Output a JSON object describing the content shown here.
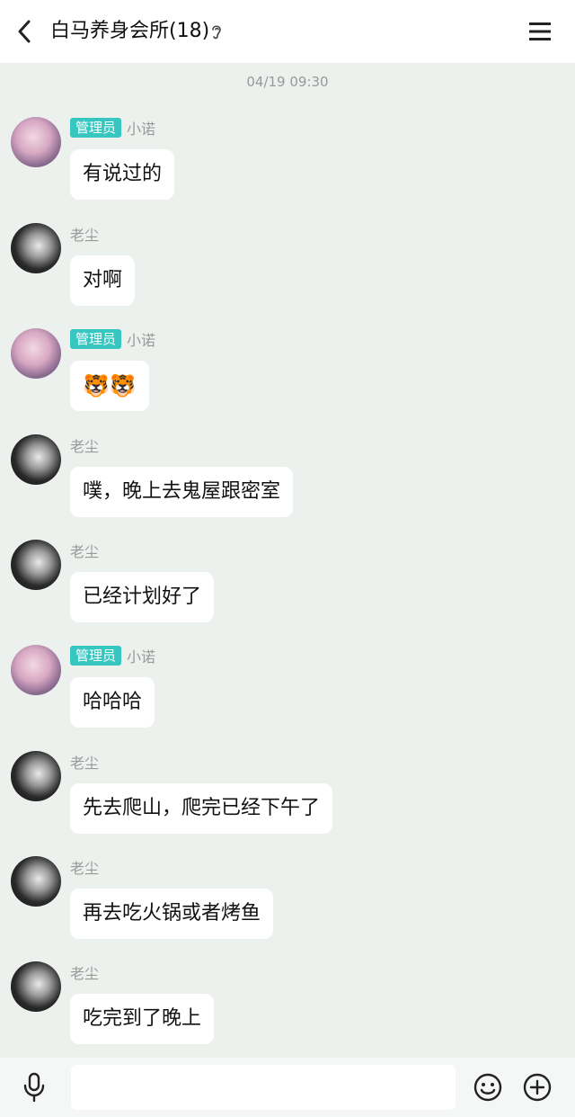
{
  "header": {
    "title": "白马养身会所(18)"
  },
  "timestamp": "04/19 09:30",
  "messages": [
    {
      "sender": "小诺",
      "badge": "管理员",
      "text": "有说过的"
    },
    {
      "sender": "老尘",
      "text": "对啊"
    },
    {
      "sender": "小诺",
      "badge": "管理员",
      "text": "🐯🐯"
    },
    {
      "sender": "老尘",
      "text": "噗，晚上去鬼屋跟密室"
    },
    {
      "sender": "老尘",
      "text": "已经计划好了"
    },
    {
      "sender": "小诺",
      "badge": "管理员",
      "text": "哈哈哈"
    },
    {
      "sender": "老尘",
      "text": "先去爬山，爬完已经下午了"
    },
    {
      "sender": "老尘",
      "text": "再去吃火锅或者烤鱼"
    },
    {
      "sender": "老尘",
      "text": "吃完到了晚上"
    }
  ],
  "bottom": {
    "input_value": ""
  }
}
